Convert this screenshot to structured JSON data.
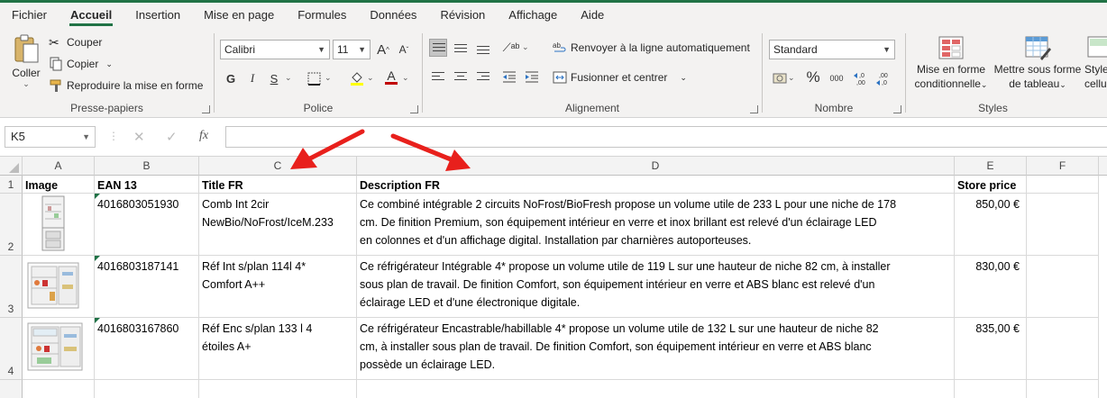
{
  "menu": {
    "tabs": [
      "Fichier",
      "Accueil",
      "Insertion",
      "Mise en page",
      "Formules",
      "Données",
      "Révision",
      "Affichage",
      "Aide"
    ],
    "active": "Accueil"
  },
  "ribbon": {
    "clipboard": {
      "label": "Presse-papiers",
      "paste": "Coller",
      "cut": "Couper",
      "copy": "Copier",
      "format_painter": "Reproduire la mise en forme"
    },
    "font": {
      "label": "Police",
      "font_name": "Calibri",
      "font_size": "11",
      "bold": "G",
      "italic": "I",
      "underline": "S",
      "grow": "A",
      "shrink": "A"
    },
    "alignment": {
      "label": "Alignement",
      "wrap": "Renvoyer à la ligne automatiquement",
      "merge": "Fusionner et centrer"
    },
    "number": {
      "label": "Nombre",
      "format": "Standard",
      "percent": "%",
      "thousands": "000"
    },
    "styles": {
      "label": "Styles",
      "conditional": [
        "Mise en forme",
        "conditionnelle"
      ],
      "table": [
        "Mettre sous forme",
        "de tableau"
      ],
      "cell_styles": [
        "Styles",
        "cellules"
      ]
    }
  },
  "formula_bar": {
    "name_box": "K5",
    "fx": "fx",
    "content": ""
  },
  "sheet": {
    "columns": [
      "A",
      "B",
      "C",
      "D",
      "E",
      "F"
    ],
    "rows": [
      "1",
      "2",
      "3",
      "4"
    ],
    "headers": [
      "Image",
      "EAN 13",
      "Title FR",
      "Description FR",
      "Store price"
    ],
    "data": [
      {
        "ean": "4016803051930",
        "title": [
          "Comb Int 2cir",
          "NewBio/NoFrost/IceM.233"
        ],
        "description": [
          "Ce combiné intégrable 2 circuits NoFrost/BioFresh propose un volume utile de 233 L pour une niche de 178",
          "cm. De finition Premium, son équipement intérieur en verre et inox brillant est relevé d'un éclairage LED",
          "en colonnes et d'un affichage digital. Installation par charnières autoporteuses."
        ],
        "price": "850,00 €"
      },
      {
        "ean": "4016803187141",
        "title": [
          "Réf Int s/plan 114l 4*",
          "Comfort A++"
        ],
        "description": [
          "Ce réfrigérateur Intégrable 4* propose un volume utile de 119 L sur une hauteur de niche 82 cm, à installer",
          "sous plan de travail. De finition Comfort, son équipement intérieur en verre et ABS blanc est relevé d'un",
          "éclairage LED et d'une électronique digitale."
        ],
        "price": "830,00 €"
      },
      {
        "ean": "4016803167860",
        "title": [
          "Réf Enc s/plan 133 l 4",
          "étoiles A+"
        ],
        "description": [
          "Ce réfrigérateur Encastrable/habillable 4* propose un volume utile de 132 L sur une hauteur de niche 82",
          "cm, à installer sous plan de travail. De finition Comfort, son équipement intérieur en verre et ABS blanc",
          "possède un éclairage LED."
        ],
        "price": "835,00 €"
      }
    ]
  },
  "colors": {
    "accent": "#217346",
    "annotation_arrow": "#e8201c",
    "font_color": "#c00000"
  }
}
